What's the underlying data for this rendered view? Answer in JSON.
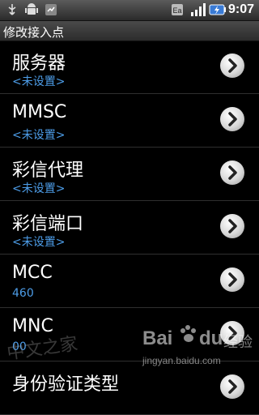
{
  "status_bar": {
    "time": "9:07",
    "icons": [
      "usb-icon",
      "android-debug-icon",
      "missed-call-icon",
      "data-transfer-icon",
      "signal-icon",
      "battery-charging-icon"
    ]
  },
  "title": "修改接入点",
  "items": [
    {
      "label": "服务器",
      "value": "<未设置>"
    },
    {
      "label": "MMSC",
      "value": "<未设置>"
    },
    {
      "label": "彩信代理",
      "value": "<未设置>"
    },
    {
      "label": "彩信端口",
      "value": "<未设置>"
    },
    {
      "label": "MCC",
      "value": "460"
    },
    {
      "label": "MNC",
      "value": "00"
    },
    {
      "label": "身份验证类型",
      "value": ""
    }
  ],
  "watermark": {
    "text1": "中文之家",
    "brand": "Bai",
    "brand_suffix": "du",
    "brand_cn": "经验",
    "site": "jingyan.baidu.com"
  }
}
